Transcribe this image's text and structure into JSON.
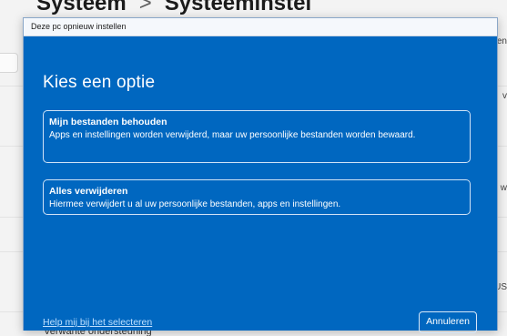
{
  "background": {
    "header_left": "Systeem",
    "header_separator": ">",
    "header_right": "Systeeminstel",
    "right_snippets": [
      "en",
      "v",
      "w",
      "US"
    ],
    "bottom_text": "Verwante ondersteuning"
  },
  "dialog": {
    "window_title": "Deze pc opnieuw instellen",
    "heading": "Kies een optie",
    "options": [
      {
        "title": "Mijn bestanden behouden",
        "description": "Apps en instellingen worden verwijderd, maar uw persoonlijke bestanden worden bewaard."
      },
      {
        "title": "Alles verwijderen",
        "description": "Hiermee verwijdert u al uw persoonlijke bestanden, apps en instellingen."
      }
    ],
    "help_link": "Help mij bij het selecteren",
    "cancel_label": "Annuleren"
  },
  "colors": {
    "dialog_background": "#0067c0",
    "titlebar_background": "#f5f8fc",
    "link": "#bfe0ff",
    "option_border": "#cfe3f7"
  }
}
